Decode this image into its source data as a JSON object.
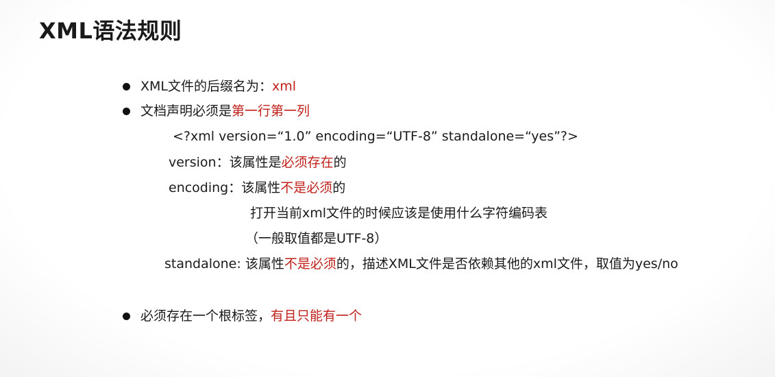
{
  "title": "XML语法规则",
  "colors": {
    "accent": "#c0201a",
    "text": "#1a1a1a"
  },
  "bullet1": {
    "text": "XML文件的后缀名为：",
    "highlight": "xml"
  },
  "bullet2": {
    "text": "文档声明必须是",
    "highlight": "第一行第一列"
  },
  "declaration": "<?xml version=“1.0” encoding=“UTF-8” standalone=“yes”?>",
  "version_line": {
    "label": "version：该属性是",
    "highlight": "必须存在",
    "tail": "的"
  },
  "encoding_line": {
    "label": "encoding：该属性",
    "highlight": "不是必须",
    "tail": "的"
  },
  "encoding_desc1": "打开当前xml文件的时候应该是使用什么字符编码表",
  "encoding_desc2": "（一般取值都是UTF-8）",
  "standalone_line": {
    "label": "standalone:  该属性",
    "highlight": "不是必须",
    "tail": "的，描述XML文件是否依赖其他的xml文件，取值为yes/no"
  },
  "bullet3": {
    "text": "必须存在一个根标签，",
    "highlight": "有且只能有一个"
  }
}
